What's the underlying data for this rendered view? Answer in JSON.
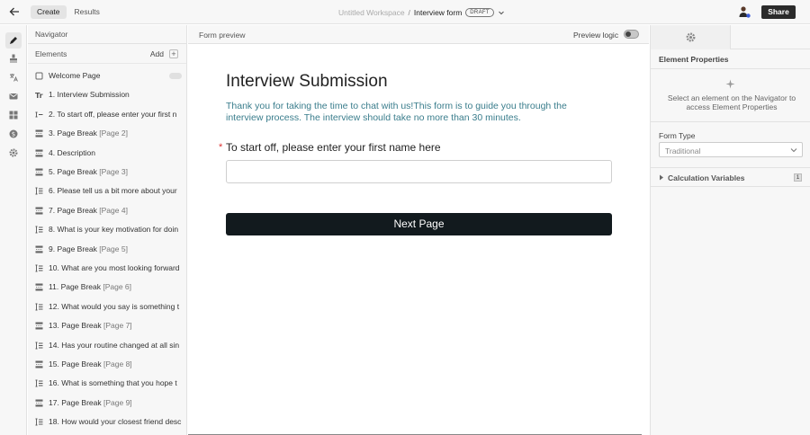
{
  "topbar": {
    "tabs": [
      "Create",
      "Results"
    ],
    "breadcrumb": {
      "workspace": "Untitled Workspace",
      "separator": "/",
      "form": "Interview form",
      "status": "DRAFT"
    },
    "share_label": "Share"
  },
  "navigator": {
    "title": "Navigator",
    "elements_label": "Elements",
    "add_label": "Add",
    "add_symbol": "+",
    "items": [
      {
        "num": "",
        "text": "Welcome Page",
        "page": "",
        "icon": "page-icon"
      },
      {
        "num": "1.",
        "text": "Interview Submission",
        "page": "",
        "icon": "text-icon"
      },
      {
        "num": "2.",
        "text": "To start off, please enter your first n",
        "page": "",
        "icon": "short-answer-icon"
      },
      {
        "num": "3.",
        "text": "Page Break",
        "page": "[Page 2]",
        "icon": "page-break-icon"
      },
      {
        "num": "4.",
        "text": "Description",
        "page": "",
        "icon": "page-break-icon"
      },
      {
        "num": "5.",
        "text": "Page Break",
        "page": "[Page 3]",
        "icon": "page-break-icon"
      },
      {
        "num": "6.",
        "text": "Please tell us a bit more about your",
        "page": "",
        "icon": "long-answer-icon"
      },
      {
        "num": "7.",
        "text": "Page Break",
        "page": "[Page 4]",
        "icon": "page-break-icon"
      },
      {
        "num": "8.",
        "text": "What is your key motivation for doin",
        "page": "",
        "icon": "long-answer-icon"
      },
      {
        "num": "9.",
        "text": "Page Break",
        "page": "[Page 5]",
        "icon": "page-break-icon"
      },
      {
        "num": "10.",
        "text": "What are you most looking forward",
        "page": "",
        "icon": "long-answer-icon"
      },
      {
        "num": "11.",
        "text": "Page Break",
        "page": "[Page 6]",
        "icon": "page-break-icon"
      },
      {
        "num": "12.",
        "text": "What would you say is something t",
        "page": "",
        "icon": "long-answer-icon"
      },
      {
        "num": "13.",
        "text": "Page Break",
        "page": "[Page 7]",
        "icon": "page-break-icon"
      },
      {
        "num": "14.",
        "text": "Has your routine changed at all sin",
        "page": "",
        "icon": "long-answer-icon"
      },
      {
        "num": "15.",
        "text": "Page Break",
        "page": "[Page 8]",
        "icon": "page-break-icon"
      },
      {
        "num": "16.",
        "text": "What is something that you hope t",
        "page": "",
        "icon": "long-answer-icon"
      },
      {
        "num": "17.",
        "text": "Page Break",
        "page": "[Page 9]",
        "icon": "page-break-icon"
      },
      {
        "num": "18.",
        "text": "How would your closest friend desc",
        "page": "",
        "icon": "long-answer-icon"
      }
    ]
  },
  "preview": {
    "header": "Form preview",
    "logic_label": "Preview logic",
    "logic_on": false,
    "form_title": "Interview Submission",
    "form_description": "Thank you for taking the time to chat with us!This form is to guide you through the interview process. The interview should take no more than 30 minutes.",
    "required_marker": "*",
    "question": "To start off, please enter your first name here",
    "answer_value": "",
    "next_button": "Next Page"
  },
  "properties": {
    "title": "Element Properties",
    "hint": "Select an element on the Navigator to access Element Properties",
    "form_type_label": "Form Type",
    "form_type_value": "Traditional",
    "calc_label": "Calculation Variables",
    "calc_count": "1"
  },
  "colors": {
    "accent_text": "#3a7d8c",
    "button": "#121a1e",
    "required": "#dd3333"
  }
}
